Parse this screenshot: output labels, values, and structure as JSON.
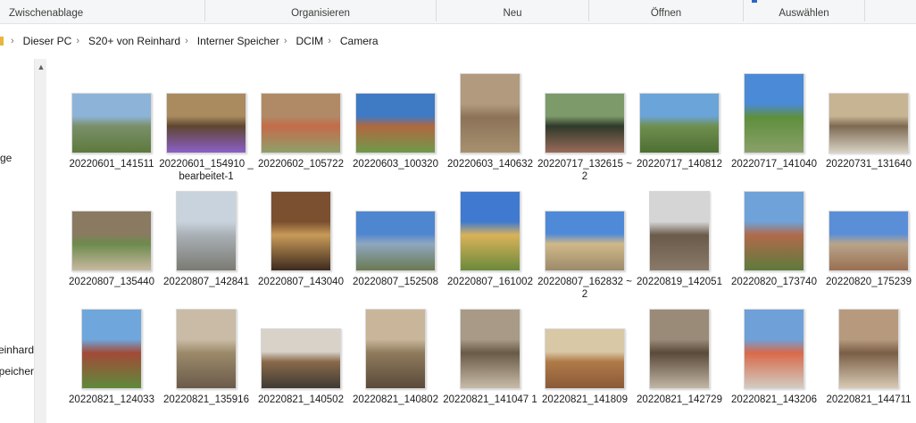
{
  "ribbon": {
    "groups": [
      "Zwischenablage",
      "Organisieren",
      "Neu",
      "Öffnen",
      "Auswählen"
    ]
  },
  "address": {
    "crumbs": [
      "Dieser PC",
      "S20+ von Reinhard",
      "Interner Speicher",
      "DCIM",
      "Camera"
    ]
  },
  "nav": {
    "items": [
      "ge",
      "einhard",
      "peicher"
    ]
  },
  "files": [
    {
      "name": "20220601_141511",
      "shape": "land",
      "colors": [
        "#8db4d8",
        "#7a8f6a",
        "#5d7a3c"
      ]
    },
    {
      "name": "20220601_154910 _bearbeitet-1",
      "shape": "land",
      "colors": [
        "#a98b5f",
        "#5e4630",
        "#8b5fc9"
      ]
    },
    {
      "name": "20220602_105722",
      "shape": "land",
      "colors": [
        "#b08a66",
        "#c46b4a",
        "#8ea06a"
      ]
    },
    {
      "name": "20220603_100320",
      "shape": "land",
      "colors": [
        "#3f7ac4",
        "#b06840",
        "#6f9a4a"
      ]
    },
    {
      "name": "20220603_140632",
      "shape": "port",
      "colors": [
        "#b19a7e",
        "#8c7358",
        "#a7906f"
      ]
    },
    {
      "name": "20220717_132615 ~2",
      "shape": "land",
      "colors": [
        "#7c9a6a",
        "#2f3a2a",
        "#9a6a5a"
      ]
    },
    {
      "name": "20220717_140812",
      "shape": "land",
      "colors": [
        "#6aa4d8",
        "#6f8f4f",
        "#4e6f33"
      ]
    },
    {
      "name": "20220717_141040",
      "shape": "port",
      "colors": [
        "#4a8ad6",
        "#5e8f3c",
        "#8aa06a"
      ]
    },
    {
      "name": "20220731_131640",
      "shape": "land",
      "colors": [
        "#c7b493",
        "#7d6a52",
        "#d9d2c4"
      ]
    },
    {
      "name": "20220807_135440",
      "shape": "land",
      "colors": [
        "#8a7a62",
        "#6d8a4c",
        "#c8b9a0"
      ]
    },
    {
      "name": "20220807_142841",
      "shape": "port",
      "colors": [
        "#c9d3dd",
        "#a9b0b5",
        "#7a7a72"
      ]
    },
    {
      "name": "20220807_143040",
      "shape": "port",
      "colors": [
        "#7a5030",
        "#c89a58",
        "#3d2a1f"
      ]
    },
    {
      "name": "20220807_152508",
      "shape": "land",
      "colors": [
        "#4f86d0",
        "#8fa7bf",
        "#6a7a52"
      ]
    },
    {
      "name": "20220807_161002",
      "shape": "port",
      "colors": [
        "#3f7ad0",
        "#d9b25a",
        "#6b8a3a"
      ]
    },
    {
      "name": "20220807_162832 ~2",
      "shape": "land",
      "colors": [
        "#4f8ad8",
        "#d0b889",
        "#9c8a6a"
      ]
    },
    {
      "name": "20220819_142051",
      "shape": "port",
      "colors": [
        "#d5d5d5",
        "#6a5a4a",
        "#8a7a6a"
      ]
    },
    {
      "name": "20220820_173740",
      "shape": "port",
      "colors": [
        "#6fa2d8",
        "#b06a4a",
        "#5e7a3c"
      ]
    },
    {
      "name": "20220820_175239",
      "shape": "land",
      "colors": [
        "#5a8fd8",
        "#b9a48a",
        "#9a6f52"
      ]
    },
    {
      "name": "20220821_124033",
      "shape": "port",
      "colors": [
        "#6fa6dc",
        "#a24a38",
        "#5e8a3a"
      ]
    },
    {
      "name": "20220821_135916",
      "shape": "port",
      "colors": [
        "#c9bba5",
        "#9c8a6a",
        "#6a5a4a"
      ]
    },
    {
      "name": "20220821_140502",
      "shape": "land",
      "colors": [
        "#d8d2c8",
        "#8a6a4a",
        "#3f3a34"
      ]
    },
    {
      "name": "20220821_140802",
      "shape": "port",
      "colors": [
        "#c9b69a",
        "#8f7a5c",
        "#5a4a3a"
      ]
    },
    {
      "name": "20220821_141047 1",
      "shape": "port",
      "colors": [
        "#a89a86",
        "#6a5a48",
        "#c8bca8"
      ]
    },
    {
      "name": "20220821_141809",
      "shape": "land",
      "colors": [
        "#d9c8a6",
        "#b07a48",
        "#8a5a38"
      ]
    },
    {
      "name": "20220821_142729",
      "shape": "port",
      "colors": [
        "#9a8a78",
        "#5a4a3a",
        "#c2b6a4"
      ]
    },
    {
      "name": "20220821_143206",
      "shape": "port",
      "colors": [
        "#6fa0d8",
        "#d96a4a",
        "#d2ccc2"
      ]
    },
    {
      "name": "20220821_144711",
      "shape": "port",
      "colors": [
        "#b79a7e",
        "#7a5e46",
        "#d8cab4"
      ]
    }
  ]
}
